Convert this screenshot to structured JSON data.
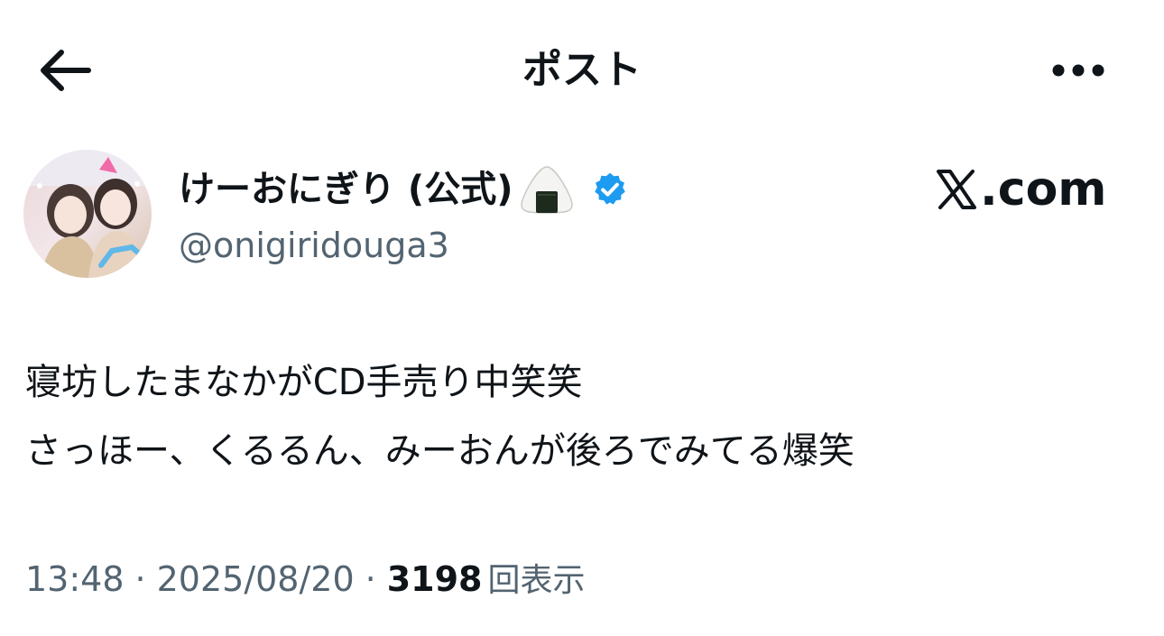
{
  "header": {
    "title": "ポスト",
    "back_icon": "arrow-left-icon",
    "more_icon": "ellipsis-icon"
  },
  "author": {
    "display_name": "けーおにぎり (公式)",
    "name_emoji": "onigiri-emoji",
    "verified_icon": "verified-badge-icon",
    "verified_color": "#1d9bf0",
    "handle": "@onigiridouga3"
  },
  "watermark": {
    "text": ".com",
    "logo_icon": "x-logo-icon"
  },
  "tweet": {
    "lines": [
      "寝坊したまなかがCD手売り中笑笑",
      "さっほー、くるるん、みーおんが後ろでみてる爆笑"
    ]
  },
  "meta": {
    "time": "13:48",
    "separator": "·",
    "date": "2025/08/20",
    "views_count": "3198",
    "views_label": "回表示"
  },
  "colors": {
    "text_primary": "#0f1419",
    "text_secondary": "#536471",
    "background": "#ffffff"
  }
}
